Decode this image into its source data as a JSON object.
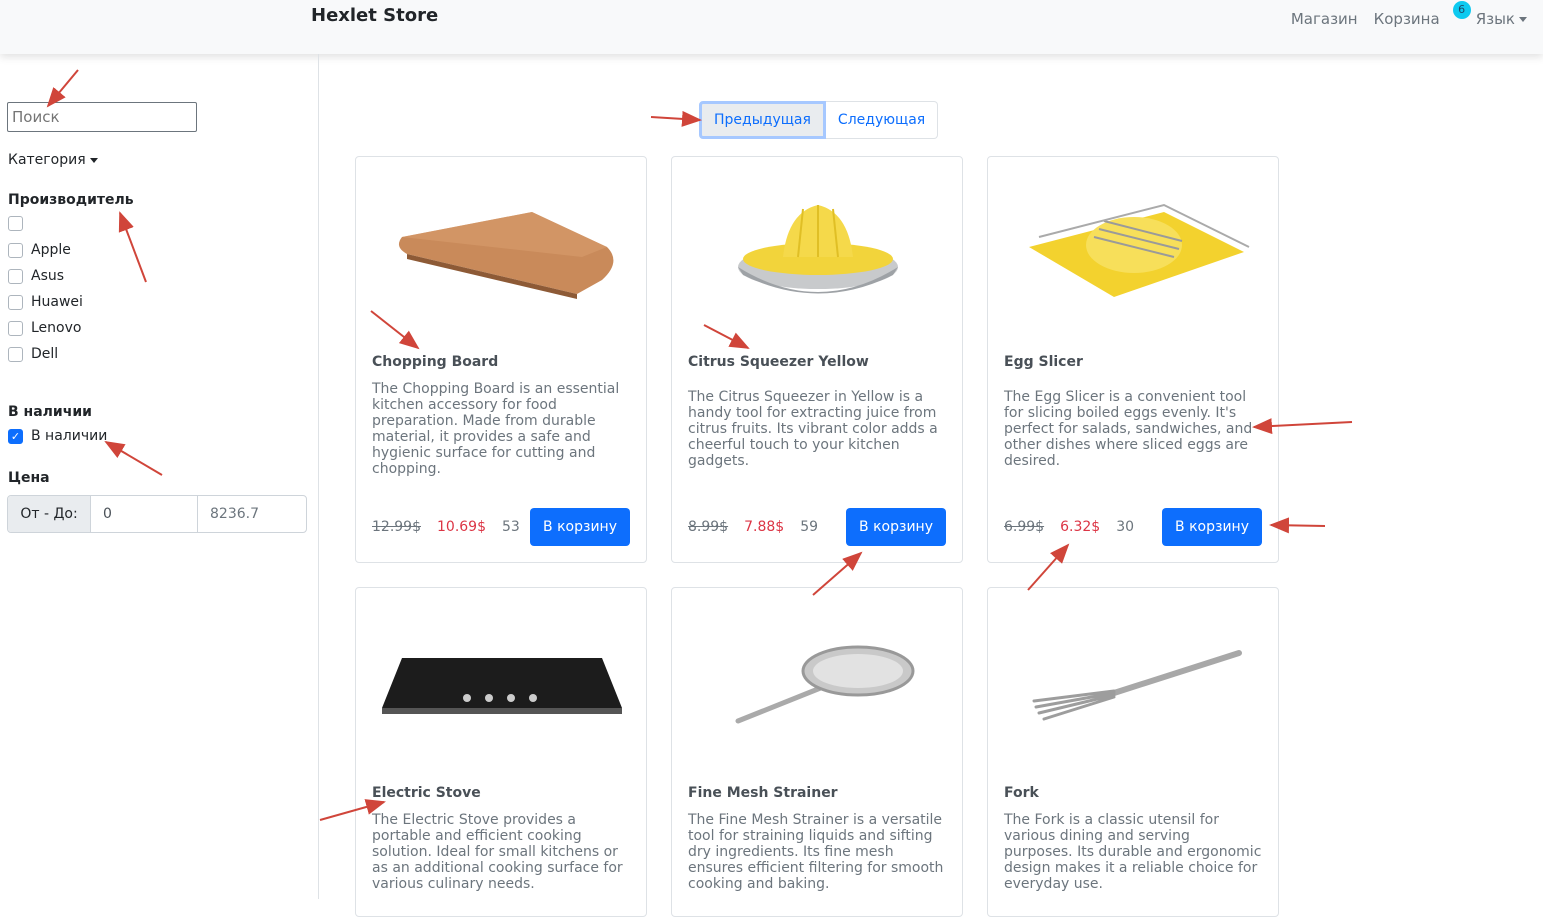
{
  "header": {
    "brand": "Hexlet Store",
    "nav": {
      "shop": "Магазин",
      "cart": "Корзина",
      "cart_count": "6",
      "language": "Язык"
    }
  },
  "sidebar": {
    "search_placeholder": "Поиск",
    "category_label": "Категория",
    "manufacturer_title": "Производитель",
    "manufacturers": [
      "",
      "Apple",
      "Asus",
      "Huawei",
      "Lenovo",
      "Dell"
    ],
    "stock_title": "В наличии",
    "stock_checkbox_label": "В наличии",
    "stock_checked": true,
    "price_title": "Цена",
    "price_range_label": "От - До:",
    "price_min": "0",
    "price_max": "8236.7"
  },
  "pagination": {
    "prev": "Предыдущая",
    "next": "Следующая"
  },
  "products": [
    {
      "name": "Chopping Board",
      "description": "The Chopping Board is an essential kitchen accessory for food preparation. Made from durable material, it provides a safe and hygienic surface for cutting and chopping.",
      "old_price": "12.99$",
      "price": "10.69$",
      "quantity": "53",
      "button": "В корзину",
      "image": "chopping-board-image"
    },
    {
      "name": "Citrus Squeezer Yellow",
      "description": "The Citrus Squeezer in Yellow is a handy tool for extracting juice from citrus fruits. Its vibrant color adds a cheerful touch to your kitchen gadgets.",
      "old_price": "8.99$",
      "price": "7.88$",
      "quantity": "59",
      "button": "В корзину",
      "image": "citrus-squeezer-image"
    },
    {
      "name": "Egg Slicer",
      "description": "The Egg Slicer is a convenient tool for slicing boiled eggs evenly. It's perfect for salads, sandwiches, and other dishes where sliced eggs are desired.",
      "old_price": "6.99$",
      "price": "6.32$",
      "quantity": "30",
      "button": "В корзину",
      "image": "egg-slicer-image"
    },
    {
      "name": "Electric Stove",
      "description": "The Electric Stove provides a portable and efficient cooking solution. Ideal for small kitchens or as an additional cooking surface for various culinary needs.",
      "image": "electric-stove-image"
    },
    {
      "name": "Fine Mesh Strainer",
      "description": "The Fine Mesh Strainer is a versatile tool for straining liquids and sifting dry ingredients. Its fine mesh ensures efficient filtering for smooth cooking and baking.",
      "image": "strainer-image"
    },
    {
      "name": "Fork",
      "description": "The Fork is a classic utensil for various dining and serving purposes. Its durable and ergonomic design makes it a reliable choice for everyday use.",
      "image": "fork-image"
    }
  ],
  "colors": {
    "primary": "#0d6efd",
    "sale": "#dc3545",
    "annotation_arrow": "#d0453a",
    "badge": "#0dcaf0"
  }
}
